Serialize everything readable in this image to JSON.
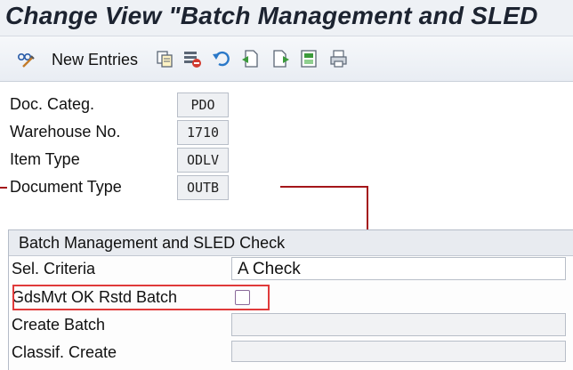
{
  "window": {
    "title": "Change View \"Batch Management and SLED"
  },
  "toolbar": {
    "new_entries_label": "New Entries",
    "icons": [
      "glasses-pen-icon",
      "copy-icon",
      "delete-icon",
      "undo-icon",
      "select-all-icon",
      "deselect-icon",
      "select-block-icon",
      "print-icon"
    ]
  },
  "header_fields": [
    {
      "label": "Doc. Categ.",
      "value": "PDO"
    },
    {
      "label": "Warehouse No.",
      "value": "1710"
    },
    {
      "label": "Item Type",
      "value": "ODLV"
    },
    {
      "label": "Document Type",
      "value": "OUTB"
    }
  ],
  "group": {
    "title": "Batch Management and SLED Check",
    "sel_criteria": {
      "label": "Sel. Criteria",
      "value": "A Check"
    },
    "gdsmvt": {
      "label": "GdsMvt OK Rstd Batch",
      "checked": false
    },
    "create_batch": {
      "label": "Create Batch",
      "value": ""
    },
    "classif_create": {
      "label": "Classif. Create",
      "value": ""
    }
  },
  "colors": {
    "highlight": "#e03a3a",
    "connector": "#a4161a"
  }
}
